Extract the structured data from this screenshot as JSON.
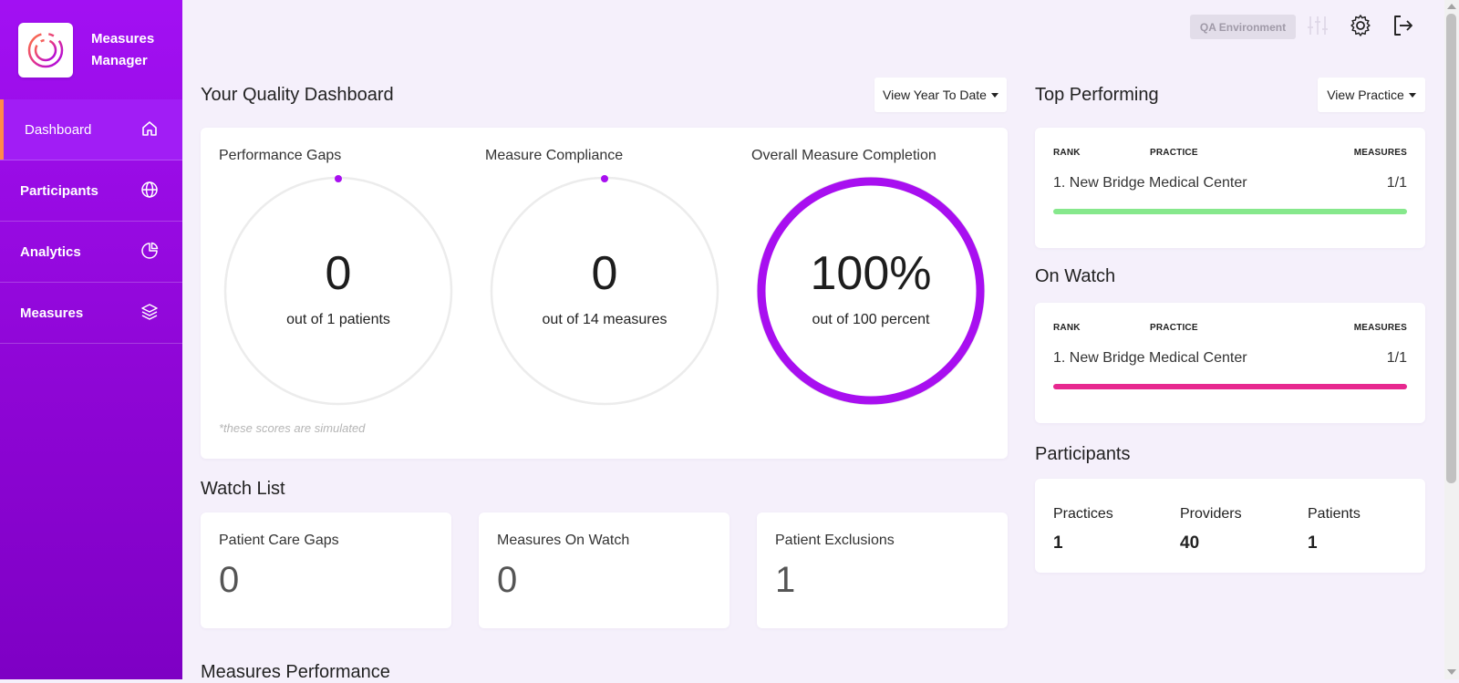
{
  "app": {
    "title_line1": "Measures",
    "title_line2": "Manager"
  },
  "sidebar": {
    "items": [
      {
        "label": "Dashboard",
        "icon": "home-icon",
        "active": true
      },
      {
        "label": "Participants",
        "icon": "globe-icon",
        "active": false
      },
      {
        "label": "Analytics",
        "icon": "pie-chart-icon",
        "active": false
      },
      {
        "label": "Measures",
        "icon": "layers-icon",
        "active": false
      }
    ]
  },
  "topbar": {
    "environment": "QA Environment",
    "icons": [
      "sliders-icon",
      "gear-icon",
      "logout-icon"
    ]
  },
  "dashboard": {
    "title": "Your Quality Dashboard",
    "range_button": "View Year To Date",
    "gauges": [
      {
        "title": "Performance Gaps",
        "value": "0",
        "subtitle": "out of 1 patients",
        "fraction": 0
      },
      {
        "title": "Measure Compliance",
        "value": "0",
        "subtitle": "out of 14 measures",
        "fraction": 0
      },
      {
        "title": "Overall Measure Completion",
        "value": "100%",
        "subtitle": "out of 100 percent",
        "fraction": 1
      }
    ],
    "note": "*these scores are simulated"
  },
  "watch_list": {
    "title": "Watch List",
    "cards": [
      {
        "label": "Patient Care Gaps",
        "value": "0"
      },
      {
        "label": "Measures On Watch",
        "value": "0"
      },
      {
        "label": "Patient Exclusions",
        "value": "1"
      }
    ]
  },
  "measures_performance": {
    "title": "Measures Performance"
  },
  "top_performing": {
    "title": "Top Performing",
    "button": "View Practice",
    "headers": [
      "RANK",
      "PRACTICE",
      "MEASURES"
    ],
    "rows": [
      {
        "name": "1. New Bridge Medical Center",
        "value": "1/1",
        "fraction": 1
      }
    ]
  },
  "on_watch": {
    "title": "On Watch",
    "headers": [
      "RANK",
      "PRACTICE",
      "MEASURES"
    ],
    "rows": [
      {
        "name": "1. New Bridge Medical Center",
        "value": "1/1",
        "fraction": 1
      }
    ]
  },
  "participants": {
    "title": "Participants",
    "stats": [
      {
        "label": "Practices",
        "value": "1"
      },
      {
        "label": "Providers",
        "value": "40"
      },
      {
        "label": "Patients",
        "value": "1"
      }
    ]
  },
  "colors": {
    "accent": "#a80ff0",
    "gauge_track": "#ececec",
    "bar_green": "#86e88c",
    "bar_pink": "#e7288f",
    "active_indicator": "#ff8a48"
  }
}
